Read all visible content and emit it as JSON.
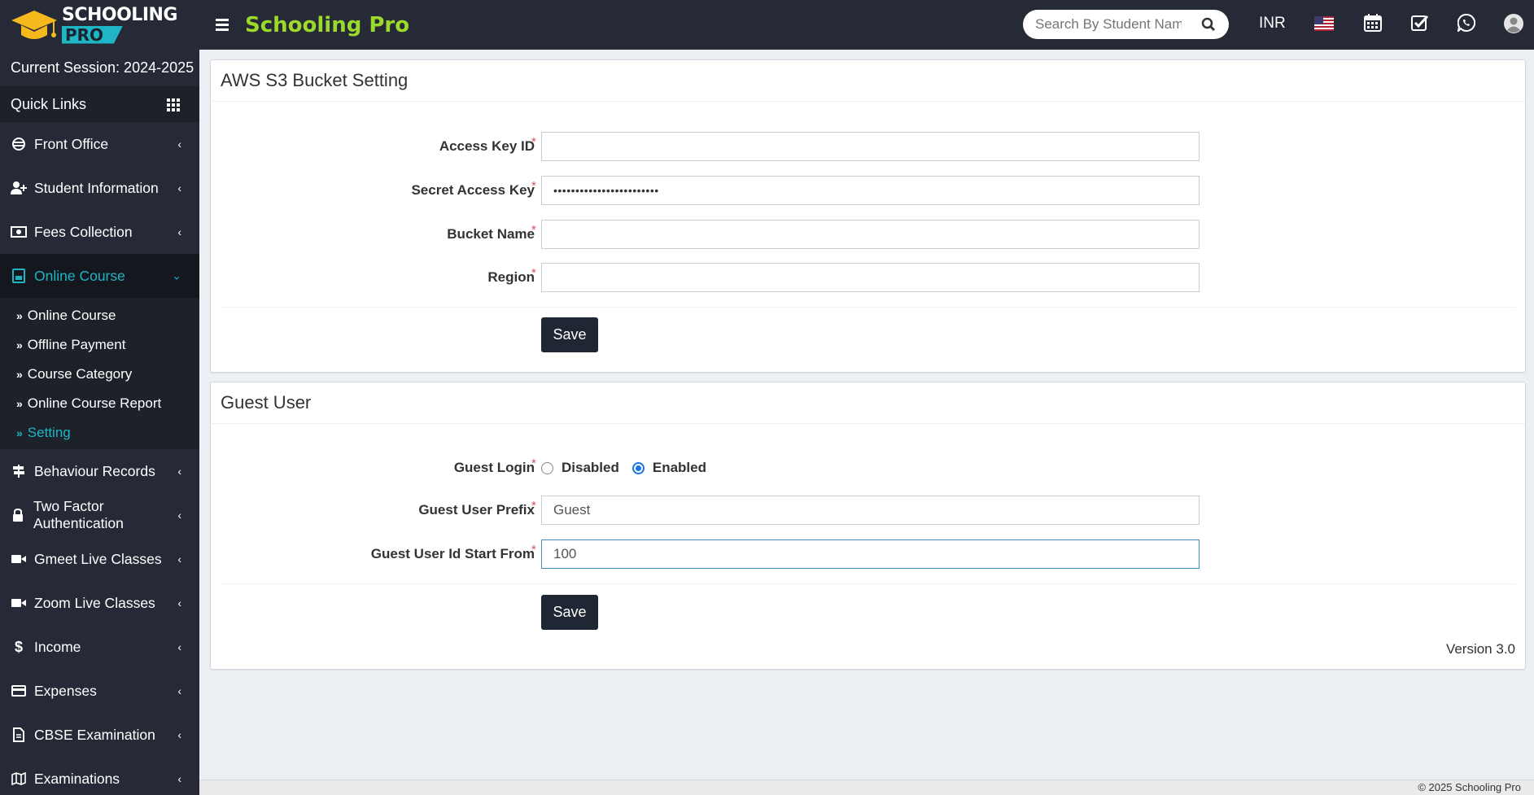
{
  "logo": {
    "line1": "SCHOOLING",
    "line2": "PRO"
  },
  "sidebar": {
    "session": "Current Session: 2024-2025",
    "quick_links": "Quick Links",
    "items_top": [
      {
        "label": "Front Office",
        "icon": "front-office-icon"
      },
      {
        "label": "Student Information",
        "icon": "user-plus-icon"
      },
      {
        "label": "Fees Collection",
        "icon": "money-icon"
      }
    ],
    "active_item": {
      "label": "Online Course",
      "icon": "online-course-icon"
    },
    "submenu": [
      {
        "label": "Online Course"
      },
      {
        "label": "Offline Payment"
      },
      {
        "label": "Course Category"
      },
      {
        "label": "Online Course Report"
      },
      {
        "label": "Setting"
      }
    ],
    "items_bottom": [
      {
        "label": "Behaviour Records",
        "icon": "signpost-icon"
      },
      {
        "label": "Two Factor Authentication",
        "icon": "lock-icon"
      },
      {
        "label": "Gmeet Live Classes",
        "icon": "video-icon"
      },
      {
        "label": "Zoom Live Classes",
        "icon": "video-icon"
      },
      {
        "label": "Income",
        "icon": "dollar-icon"
      },
      {
        "label": "Expenses",
        "icon": "credit-card-icon"
      },
      {
        "label": "CBSE Examination",
        "icon": "document-icon"
      },
      {
        "label": "Examinations",
        "icon": "map-icon"
      }
    ]
  },
  "header": {
    "brand": "Schooling Pro",
    "search_placeholder": "Search By Student Name",
    "currency": "INR",
    "icons": [
      "us-flag-icon",
      "calendar-icon",
      "task-check-icon",
      "whatsapp-icon",
      "user-avatar-icon"
    ]
  },
  "aws": {
    "title": "AWS S3 Bucket Setting",
    "access_key_label": "Access Key ID",
    "access_key_value": "",
    "secret_key_label": "Secret Access Key",
    "secret_key_value": "••••••••••••••••••••••••",
    "bucket_label": "Bucket Name",
    "bucket_value": "",
    "region_label": "Region",
    "region_value": "",
    "save_label": "Save",
    "required_mark": "*"
  },
  "guest": {
    "title": "Guest User",
    "login_label": "Guest Login",
    "option_disabled": "Disabled",
    "option_enabled": "Enabled",
    "selected": "Enabled",
    "prefix_label": "Guest User Prefix",
    "prefix_value": "Guest",
    "start_label": "Guest User Id Start From",
    "start_value": "100",
    "save_label": "Save",
    "required_mark": "*"
  },
  "version": "Version 3.0",
  "footer": "© 2025 Schooling Pro",
  "colors": {
    "sidebar_bg": "#252a36",
    "accent_teal": "#1fb5c4",
    "brand_green": "#9bd92b",
    "required_red": "#d9534f"
  }
}
